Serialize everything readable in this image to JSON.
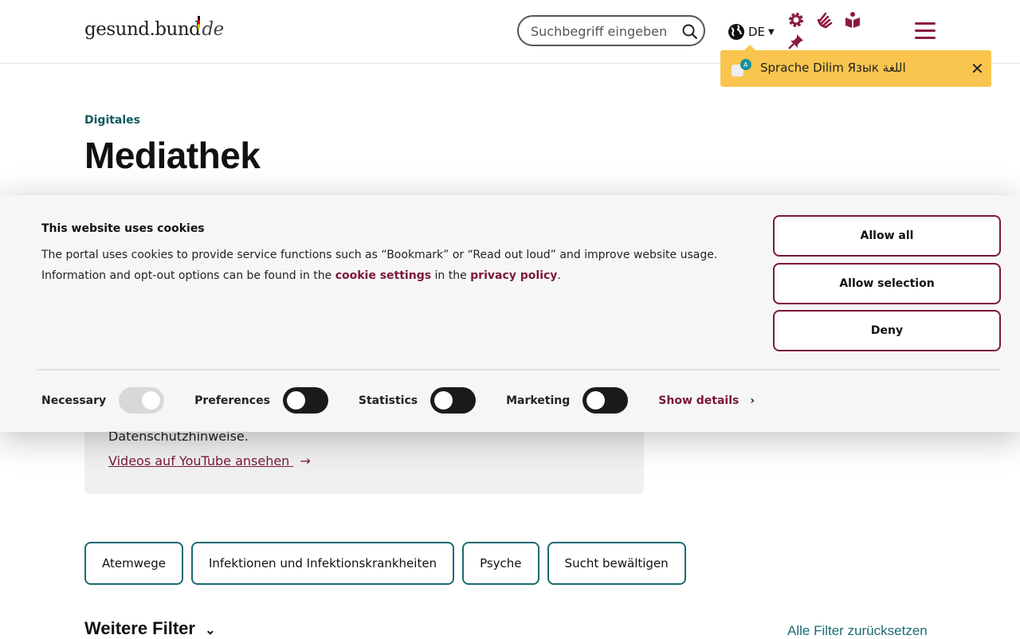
{
  "header": {
    "logo_main": "gesund.bund",
    "logo_suffix": "de",
    "search_placeholder": "Suchbegriff eingeben",
    "language": "DE"
  },
  "language_tip": {
    "text": "Sprache Dilim Язык اللغة"
  },
  "page": {
    "eyebrow": "Digitales",
    "title": "Mediathek",
    "info_text": "Datenschutzhinweise.",
    "youtube_link": "Videos auf YouTube ansehen"
  },
  "filters": {
    "chips": [
      "Atemwege",
      "Infektionen und Infektionskrankheiten",
      "Psyche",
      "Sucht bewältigen"
    ],
    "more_label": "Weitere Filter",
    "reset_label": "Alle Filter zurücksetzen"
  },
  "cookie": {
    "title": "This website uses cookies",
    "text_before": "The portal uses cookies to provide service functions such as “Bookmark” or “Read out loud” and improve website usage. Information and opt-out options can be found in the ",
    "link1": "cookie settings",
    "text_middle": " in the ",
    "link2": "privacy policy",
    "text_after": ".",
    "buttons": {
      "allow_all": "Allow all",
      "allow_selection": "Allow selection",
      "deny": "Deny"
    },
    "categories": {
      "necessary": "Necessary",
      "preferences": "Preferences",
      "statistics": "Statistics",
      "marketing": "Marketing"
    },
    "toggles": {
      "necessary": true,
      "preferences": false,
      "statistics": false,
      "marketing": false
    },
    "show_details": "Show details"
  },
  "colors": {
    "brand": "#8a1c3d",
    "accent_teal": "#1a6b72",
    "tip_yellow": "#f9c54e"
  }
}
